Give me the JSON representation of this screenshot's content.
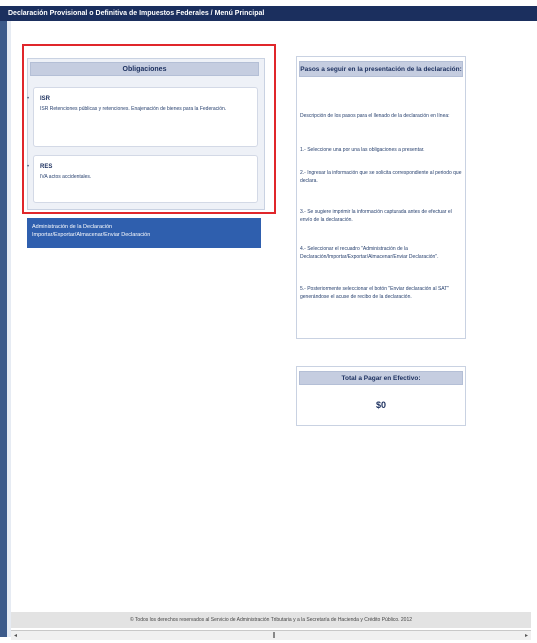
{
  "window": {
    "title": "Declaración Provisional o Definitiva de Impuestos Federales / Menú Principal"
  },
  "obligaciones": {
    "header": "Obligaciones",
    "items": [
      {
        "code": "ISR",
        "description": "ISR Retenciones públicas y retenciones. Enajenación de bienes para la Federación."
      },
      {
        "code": "RES",
        "description": "IVA actos accidentales."
      }
    ]
  },
  "admin": {
    "line1": "Administración de la Declaración",
    "line2": "Importar/Exportar/Almacenar/Enviar Declaración"
  },
  "pasos": {
    "header": "Pasos a seguir en la presentación de la declaración:",
    "intro": "Descripción de los pasos para el llenado de la declaración en línea:",
    "steps": [
      "1.- Seleccione una por una las obligaciones a presentar.",
      "2.- Ingresar la información que se solicita correspondiente al periodo que declara.",
      "3.- Se sugiere imprimir la información capturada antes de efectuar el envío de la declaración.",
      "4.- Seleccionar el recuadro \"Administración de la Declaración/Importar/Exportar/Almacenar/Enviar Declaración\".",
      "5.- Posteriormente seleccionar el botón \"Enviar declaración al SAT\" generándose el acuse de recibo de la declaración."
    ]
  },
  "total": {
    "header": "Total a Pagar en Efectivo:",
    "amount": "$0"
  },
  "footer": {
    "text": "© Todos los derechos reservados al Servicio de Administración Tributaria y a la Secretaría de Hacienda y Crédito Público. 2012"
  }
}
